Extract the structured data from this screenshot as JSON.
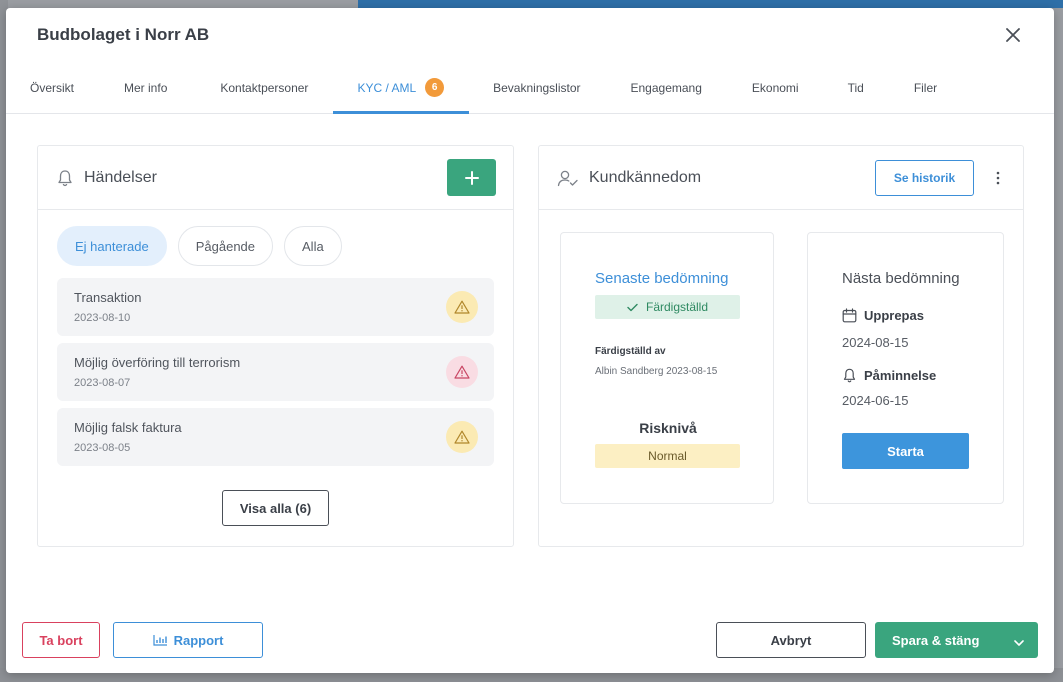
{
  "modal": {
    "title": "Budbolaget i Norr AB"
  },
  "tabs": [
    {
      "label": "Översikt"
    },
    {
      "label": "Mer info"
    },
    {
      "label": "Kontaktpersoner"
    },
    {
      "label": "KYC / AML",
      "badge": "6",
      "active": true
    },
    {
      "label": "Bevakningslistor"
    },
    {
      "label": "Engagemang"
    },
    {
      "label": "Ekonomi"
    },
    {
      "label": "Tid"
    },
    {
      "label": "Filer"
    }
  ],
  "events_panel": {
    "title": "Händelser",
    "filters": [
      "Ej hanterade",
      "Pågående",
      "Alla"
    ],
    "items": [
      {
        "title": "Transaktion",
        "date": "2023-08-10",
        "severity": "warning"
      },
      {
        "title": "Möjlig överföring till terrorism",
        "date": "2023-08-07",
        "severity": "danger"
      },
      {
        "title": "Möjlig falsk faktura",
        "date": "2023-08-05",
        "severity": "warning"
      }
    ],
    "show_all_label": "Visa alla (6)"
  },
  "kyc_panel": {
    "title": "Kundkännedom",
    "history_label": "Se historik",
    "latest": {
      "title": "Senaste bedömning",
      "status": "Färdigställd",
      "completed_by_label": "Färdigställd av",
      "completed_by_value": "Albin Sandberg 2023-08-15",
      "risk_label": "Risknivå",
      "risk_value": "Normal"
    },
    "next": {
      "title": "Nästa bedömning",
      "repeat_label": "Upprepas",
      "repeat_date": "2024-08-15",
      "reminder_label": "Påminnelse",
      "reminder_date": "2024-06-15",
      "start_label": "Starta"
    }
  },
  "footer": {
    "delete_label": "Ta bort",
    "report_label": "Rapport",
    "cancel_label": "Avbryt",
    "save_label": "Spara & stäng"
  },
  "colors": {
    "accent": "#3d8fd8",
    "success": "#3aa57e",
    "danger": "#d9415e",
    "badge": "#f29a3a"
  }
}
